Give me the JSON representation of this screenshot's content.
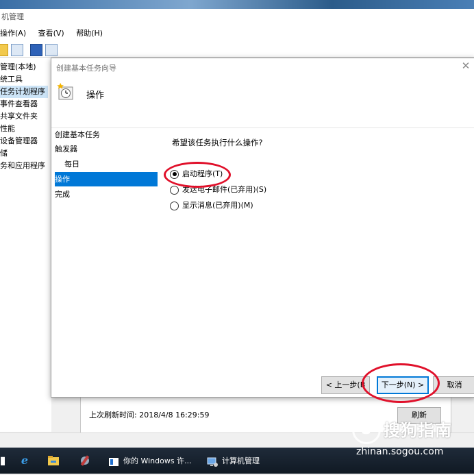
{
  "background_window": {
    "title": "机管理",
    "menu": [
      "操作(A)",
      "查看(V)",
      "帮助(H)"
    ],
    "tree": [
      {
        "label": "管理(本地)",
        "selected": false
      },
      {
        "label": "统工具",
        "selected": false
      },
      {
        "label": "任务计划程序",
        "selected": true
      },
      {
        "label": "事件查看器",
        "selected": false
      },
      {
        "label": "共享文件夹",
        "selected": false
      },
      {
        "label": "性能",
        "selected": false
      },
      {
        "label": "设备管理器",
        "selected": false
      },
      {
        "label": "储",
        "selected": false
      },
      {
        "label": "务和应用程序",
        "selected": false
      }
    ],
    "last_refresh": "上次刷新时间: 2018/4/8 16:29:59",
    "refresh_button": "刷新"
  },
  "wizard": {
    "window_title": "创建基本任务向导",
    "heading": "操作",
    "steps": [
      {
        "label": "创建基本任务",
        "active": false,
        "indent": false
      },
      {
        "label": "触发器",
        "active": false,
        "indent": false
      },
      {
        "label": "每日",
        "active": false,
        "indent": true
      },
      {
        "label": "操作",
        "active": true,
        "indent": false
      },
      {
        "label": "完成",
        "active": false,
        "indent": false
      }
    ],
    "question": "希望该任务执行什么操作?",
    "options": [
      {
        "label": "启动程序(T)",
        "checked": true
      },
      {
        "label": "发送电子邮件(已弃用)(S)",
        "checked": false
      },
      {
        "label": "显示消息(已弃用)(M)",
        "checked": false
      }
    ],
    "back_button": "< 上一步(B",
    "next_button": "下一步(N) >",
    "cancel_button": "取消"
  },
  "taskbar": {
    "apps": [
      {
        "label": "你的 Windows 许...",
        "icon": "windows-license-icon"
      },
      {
        "label": "计算机管理",
        "icon": "computer-management-icon"
      }
    ]
  },
  "watermark": {
    "logo": "S",
    "brand": "搜狗指南",
    "url": "zhinan.sogou.com"
  },
  "colors": {
    "accent": "#0078d7",
    "annotation": "#e0102a"
  }
}
